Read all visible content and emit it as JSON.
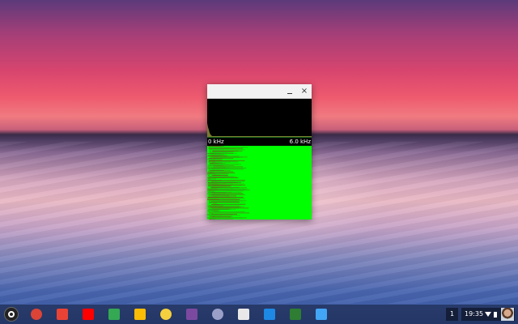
{
  "desktop": {
    "wallpaper": "sunset-over-lake"
  },
  "window": {
    "minimize_symbol": "",
    "close_symbol": "×",
    "axis": {
      "min_label": "0 kHz",
      "max_label": "6.0 kHz"
    },
    "waterfall_color": "#00ff00"
  },
  "shelf": {
    "launcher_icon": "launcher-icon",
    "apps": [
      {
        "name": "chrome",
        "icon": "chrome-icon",
        "color": "#db4437"
      },
      {
        "name": "gmail",
        "icon": "gmail-icon",
        "color": "#ea4335"
      },
      {
        "name": "youtube",
        "icon": "youtube-icon",
        "color": "#ff0000"
      },
      {
        "name": "play-store",
        "icon": "play-store-icon",
        "color": "#34a853"
      },
      {
        "name": "drive",
        "icon": "drive-icon",
        "color": "#fbbc05"
      },
      {
        "name": "keep",
        "icon": "keep-icon",
        "color": "#f4d03f"
      },
      {
        "name": "media-app",
        "icon": "media-app-icon",
        "color": "#7b4aa0"
      },
      {
        "name": "podcast",
        "icon": "podcast-icon",
        "color": "#9aa0c8"
      },
      {
        "name": "photos-app",
        "icon": "photos-app-icon",
        "color": "#e8e8e8"
      },
      {
        "name": "files",
        "icon": "files-icon",
        "color": "#1e88e5"
      },
      {
        "name": "spectrum-app",
        "icon": "spectrum-app-icon",
        "color": "#2e7d32"
      },
      {
        "name": "image-app",
        "icon": "image-app-icon",
        "color": "#42a5f5"
      }
    ],
    "workspace_badge": "1",
    "clock": "19:35"
  }
}
